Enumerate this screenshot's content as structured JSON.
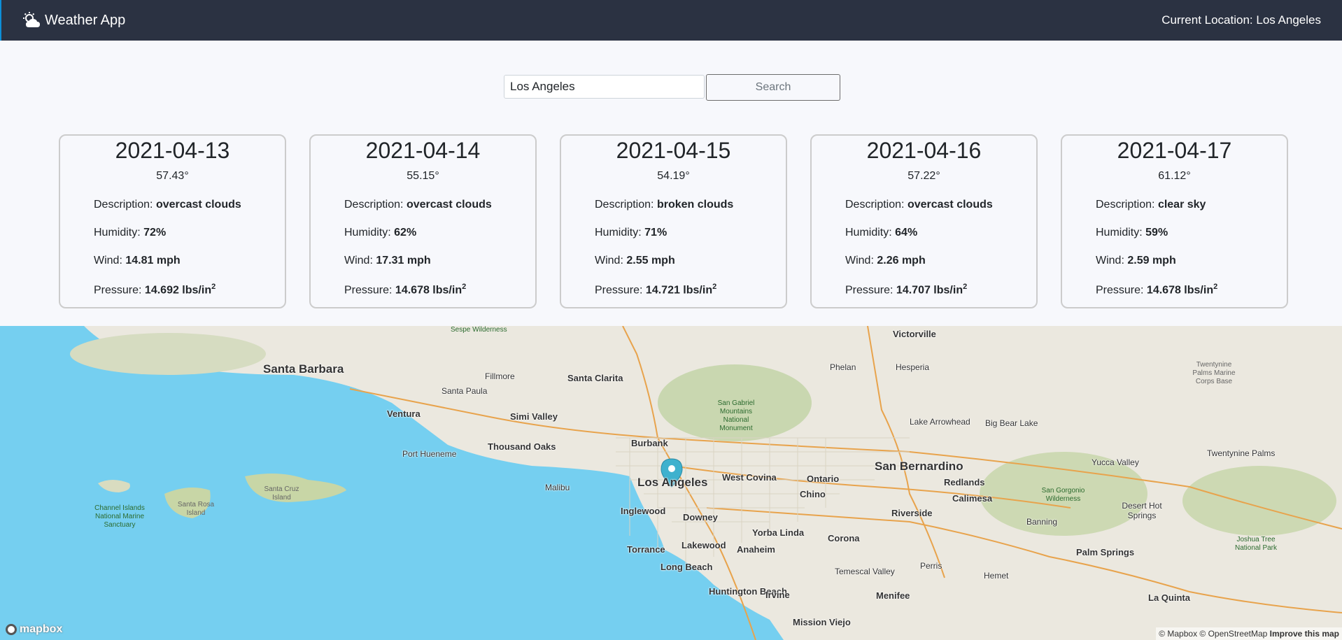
{
  "header": {
    "title": "Weather App",
    "current_location": "Current Location: Los Angeles"
  },
  "search": {
    "value": "Los Angeles",
    "button_label": "Search"
  },
  "labels": {
    "description": "Description:",
    "humidity": "Humidity:",
    "wind": "Wind:",
    "pressure": "Pressure:",
    "pressure_sup": "2"
  },
  "forecast": [
    {
      "date": "2021-04-13",
      "temp": "57.43°",
      "description": "overcast clouds",
      "humidity": "72%",
      "wind": "14.81 mph",
      "pressure": "14.692 lbs/in"
    },
    {
      "date": "2021-04-14",
      "temp": "55.15°",
      "description": "overcast clouds",
      "humidity": "62%",
      "wind": "17.31 mph",
      "pressure": "14.678 lbs/in"
    },
    {
      "date": "2021-04-15",
      "temp": "54.19°",
      "description": "broken clouds",
      "humidity": "71%",
      "wind": "2.55 mph",
      "pressure": "14.721 lbs/in"
    },
    {
      "date": "2021-04-16",
      "temp": "57.22°",
      "description": "overcast clouds",
      "humidity": "64%",
      "wind": "2.26 mph",
      "pressure": "14.707 lbs/in"
    },
    {
      "date": "2021-04-17",
      "temp": "61.12°",
      "description": "clear sky",
      "humidity": "59%",
      "wind": "2.59 mph",
      "pressure": "14.678 lbs/in"
    }
  ],
  "map": {
    "cities": {
      "santa_barbara": "Santa Barbara",
      "ventura": "Ventura",
      "port_hueneme": "Port Hueneme",
      "santa_paula": "Santa Paula",
      "fillmore": "Fillmore",
      "santa_clarita": "Santa Clarita",
      "simi_valley": "Simi Valley",
      "thousand_oaks": "Thousand Oaks",
      "burbank": "Burbank",
      "los_angeles": "Los Angeles",
      "malibu": "Malibu",
      "inglewood": "Inglewood",
      "torrance": "Torrance",
      "long_beach": "Long Beach",
      "lakewood": "Lakewood",
      "downey": "Downey",
      "west_covina": "West Covina",
      "ontario": "Ontario",
      "chino": "Chino",
      "yorba_linda": "Yorba Linda",
      "anaheim": "Anaheim",
      "huntington_beach": "Huntington Beach",
      "irvine": "Irvine",
      "mission_viejo": "Mission Viejo",
      "corona": "Corona",
      "riverside": "Riverside",
      "san_bernardino": "San Bernardino",
      "redlands": "Redlands",
      "calimesa": "Calimesa",
      "banning": "Banning",
      "temescal_valley": "Temescal Valley",
      "perris": "Perris",
      "menifee": "Menifee",
      "hemet": "Hemet",
      "victorville": "Victorville",
      "hesperia": "Hesperia",
      "phelan": "Phelan",
      "lake_arrowhead": "Lake Arrowhead",
      "big_bear_lake": "Big Bear Lake",
      "yucca_valley": "Yucca Valley",
      "twentynine_palms": "Twentynine Palms",
      "desert_hot_springs": "Desert Hot Springs",
      "palm_springs": "Palm Springs",
      "la_quinta": "La Quinta"
    },
    "parks": {
      "sespe": "Sespe Wilderness",
      "san_gabriel": "San Gabriel Mountains National Monument",
      "channel_islands": "Channel Islands National Marine Sanctuary",
      "san_gorgonio": "San Gorgonio Wilderness",
      "joshua_tree": "Joshua Tree National Park",
      "marine_base": "Twentynine Palms Marine Corps Base"
    },
    "islands": {
      "santa_cruz": "Santa Cruz Island",
      "santa_rosa": "Santa Rosa Island"
    },
    "logo": "mapbox",
    "attribution": "© Mapbox © OpenStreetMap",
    "improve": "Improve this map"
  }
}
